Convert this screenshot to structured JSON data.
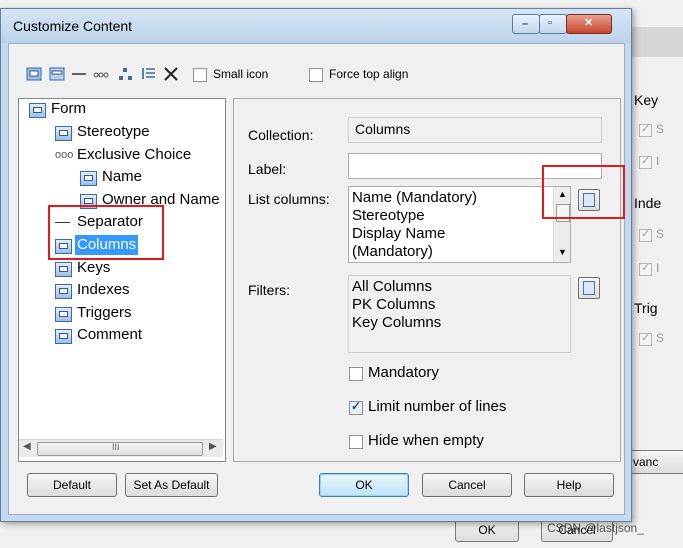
{
  "dialog": {
    "title": "Customize Content",
    "toolbar": {
      "small_icon_label": "Small icon",
      "small_icon_checked": false,
      "force_top_align_label": "Force top align",
      "force_top_align_checked": false,
      "icons": [
        "add-collection-icon",
        "add-attribute-icon",
        "separator-icon",
        "exclusive-choice-icon",
        "move-icon",
        "list-icon",
        "delete-icon"
      ]
    },
    "tree": {
      "items": [
        {
          "label": "Form",
          "icon": "form-icon"
        },
        {
          "label": "Stereotype",
          "icon": "attribute-icon"
        },
        {
          "label": "Exclusive Choice",
          "icon": "exclusive-choice-icon"
        },
        {
          "label": "Name",
          "icon": "attribute-icon"
        },
        {
          "label": "Owner and Name",
          "icon": "attribute-icon"
        },
        {
          "label": "Separator",
          "icon": "separator-icon"
        },
        {
          "label": "Columns",
          "icon": "collection-icon",
          "selected": true
        },
        {
          "label": "Keys",
          "icon": "collection-icon"
        },
        {
          "label": "Indexes",
          "icon": "collection-icon"
        },
        {
          "label": "Triggers",
          "icon": "collection-icon"
        },
        {
          "label": "Comment",
          "icon": "attribute-icon"
        }
      ],
      "scroll_thumb_glyph": "III"
    },
    "properties": {
      "collection_label": "Collection:",
      "collection_value": "Columns",
      "label_label": "Label:",
      "label_value": "",
      "list_columns_label": "List columns:",
      "list_columns": [
        "Name (Mandatory)",
        "Stereotype",
        "Display Name",
        "(Mandatory)"
      ],
      "filters_label": "Filters:",
      "filters": [
        "All Columns",
        "PK Columns",
        "Key Columns"
      ],
      "mandatory_label": "Mandatory",
      "mandatory_checked": false,
      "limit_lines_label": "Limit number of lines",
      "limit_lines_checked": true,
      "hide_empty_label": "Hide when empty",
      "hide_empty_checked": false
    },
    "buttons": {
      "default": "Default",
      "set_as_default": "Set As Default",
      "ok": "OK",
      "cancel": "Cancel",
      "help": "Help"
    }
  },
  "background_window": {
    "tabs": [
      "Key",
      "Inde",
      "Trig"
    ],
    "advanced_partial": "vanc",
    "ok_button": "OK",
    "cancel_button": "Cancel",
    "watermark": "CSDN @lastjson_"
  },
  "annotation_color": "#e3191c"
}
